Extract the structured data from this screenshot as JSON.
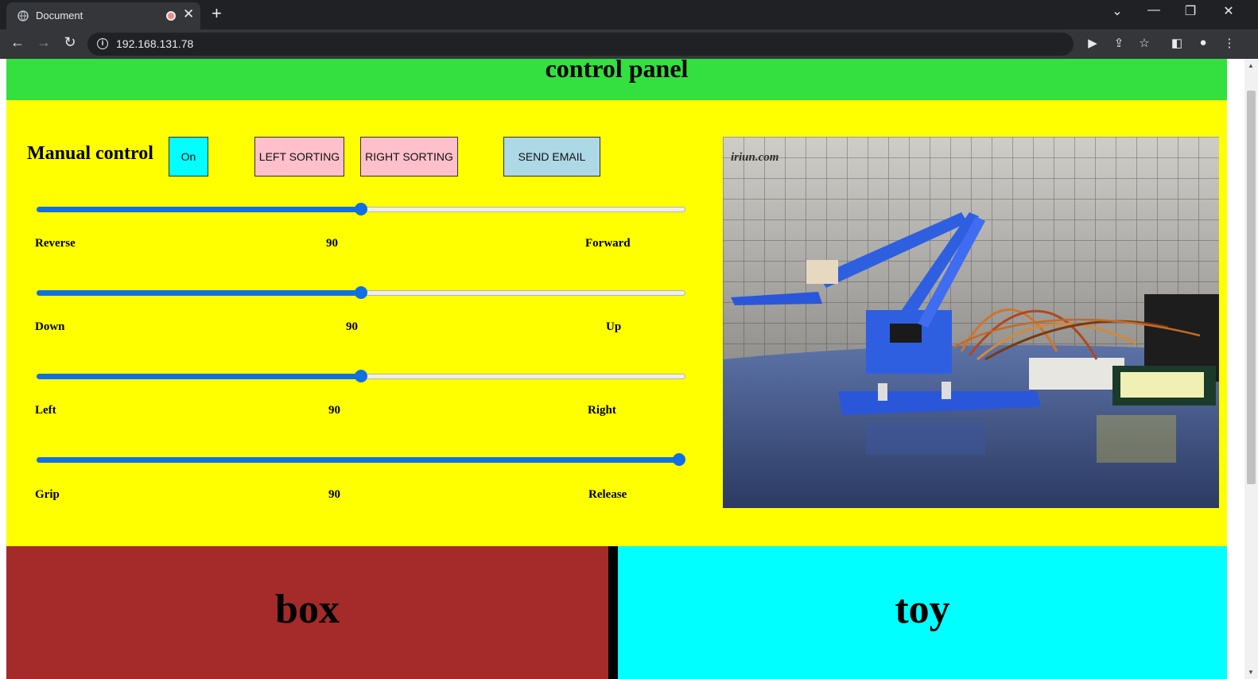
{
  "browser": {
    "tab_title": "Document",
    "url": "192.168.131.78"
  },
  "page": {
    "header_title": "control panel",
    "manual_label": "Manual control",
    "buttons": {
      "on": "On",
      "left_sorting": "LEFT SORTING",
      "right_sorting": "RIGHT SORTING",
      "send_email": "SEND EMAIL"
    },
    "sliders": [
      {
        "min_label": "Reverse",
        "value_label": "90",
        "max_label": "Forward",
        "fraction": 0.5
      },
      {
        "min_label": "Down",
        "value_label": "90",
        "max_label": "Up",
        "fraction": 0.5
      },
      {
        "min_label": "Left",
        "value_label": "90",
        "max_label": "Right",
        "fraction": 0.5
      },
      {
        "min_label": "Grip",
        "value_label": "90",
        "max_label": "Release",
        "fraction": 1.0
      }
    ],
    "camera_watermark": "iriun.com",
    "bins": {
      "left": "box",
      "right": "toy"
    }
  },
  "colors": {
    "header": "#33e03f",
    "panel": "#ffff00",
    "box_bin": "#a52a2a",
    "toy_bin": "#00ffff",
    "slider_accent": "#0f70e6"
  }
}
